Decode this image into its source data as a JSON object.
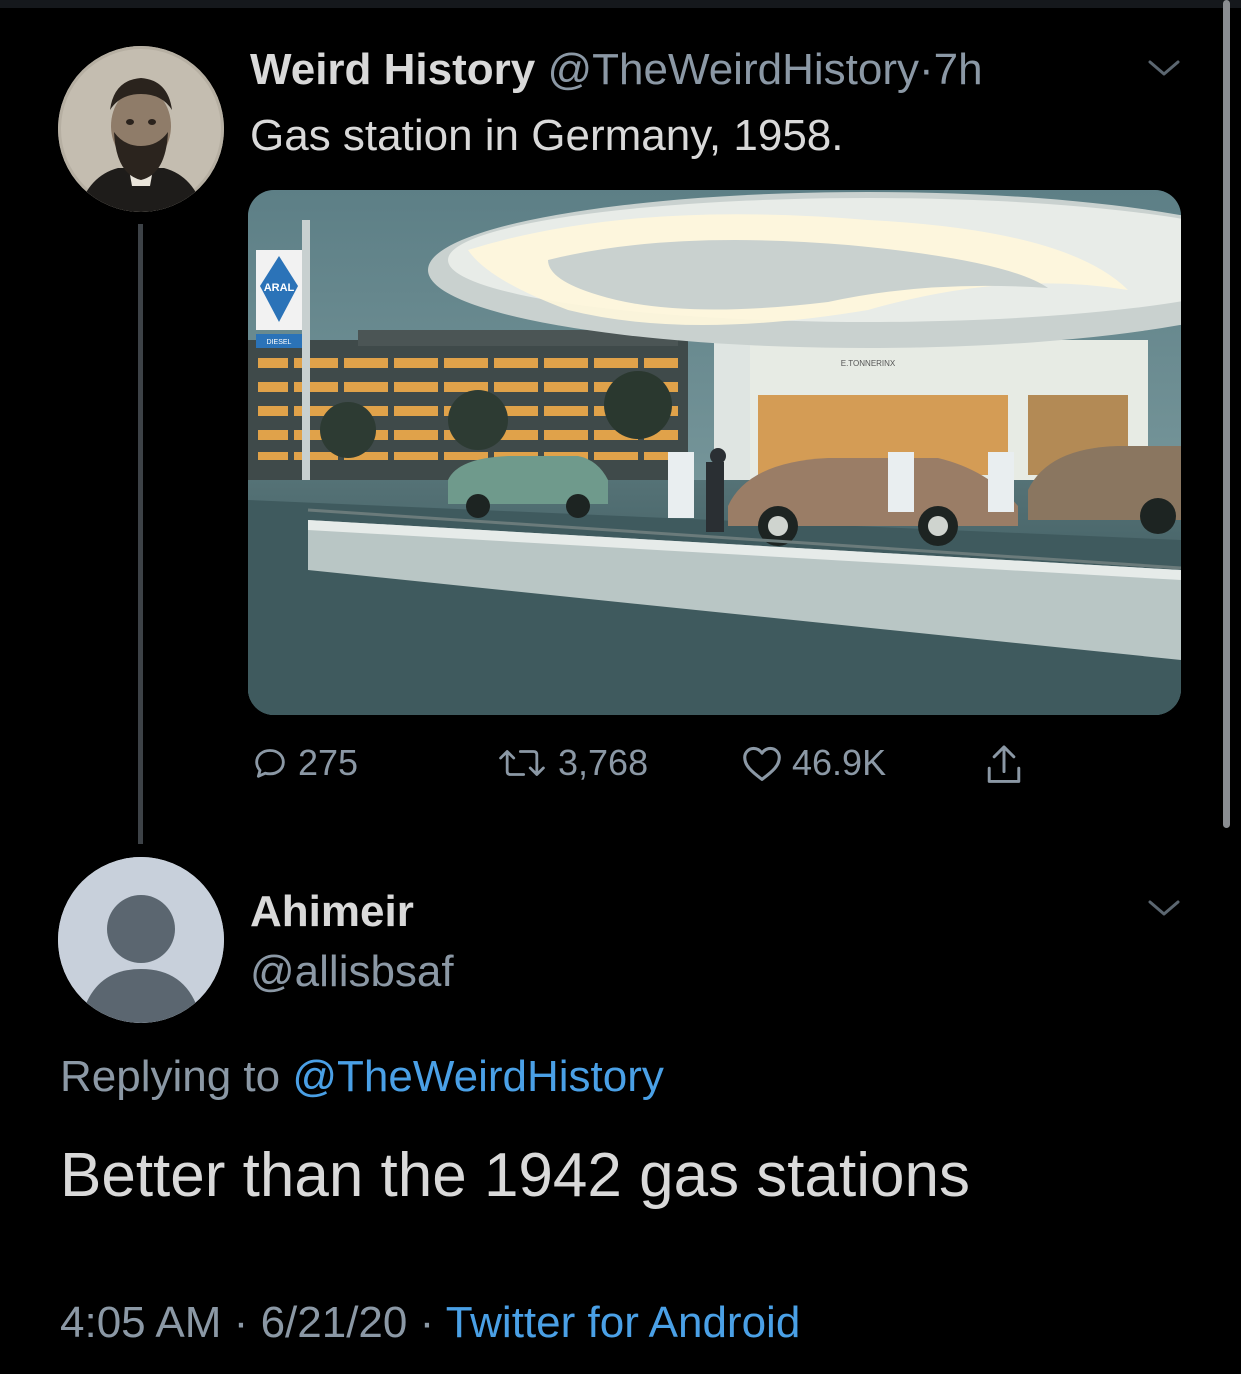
{
  "original_tweet": {
    "display_name": "Weird History",
    "handle": "@TheWeirdHistory",
    "separator": "·",
    "time_ago": "7h",
    "text": "Gas station in Germany, 1958.",
    "media": {
      "signs": {
        "brand": "ARAL",
        "diesel": "DIESEL",
        "canopy": "E.TONNERINX"
      }
    },
    "counts": {
      "replies": "275",
      "retweets": "3,768",
      "likes": "46.9K"
    }
  },
  "reply_tweet": {
    "display_name": "Ahimeir",
    "handle": "@allisbsaf",
    "replying_prefix": "Replying to",
    "replying_to": "@TheWeirdHistory",
    "text": "Better than the 1942 gas stations",
    "time": "4:05 AM",
    "date": "6/21/20",
    "separator": "·",
    "source": "Twitter for Android"
  },
  "colors": {
    "background": "#000000",
    "text": "#d9d9d9",
    "muted": "#8b98a5",
    "link": "#4aa0e6"
  },
  "icons": [
    "chevron-down-icon",
    "reply-icon",
    "retweet-icon",
    "like-icon",
    "share-icon",
    "default-avatar-icon"
  ]
}
